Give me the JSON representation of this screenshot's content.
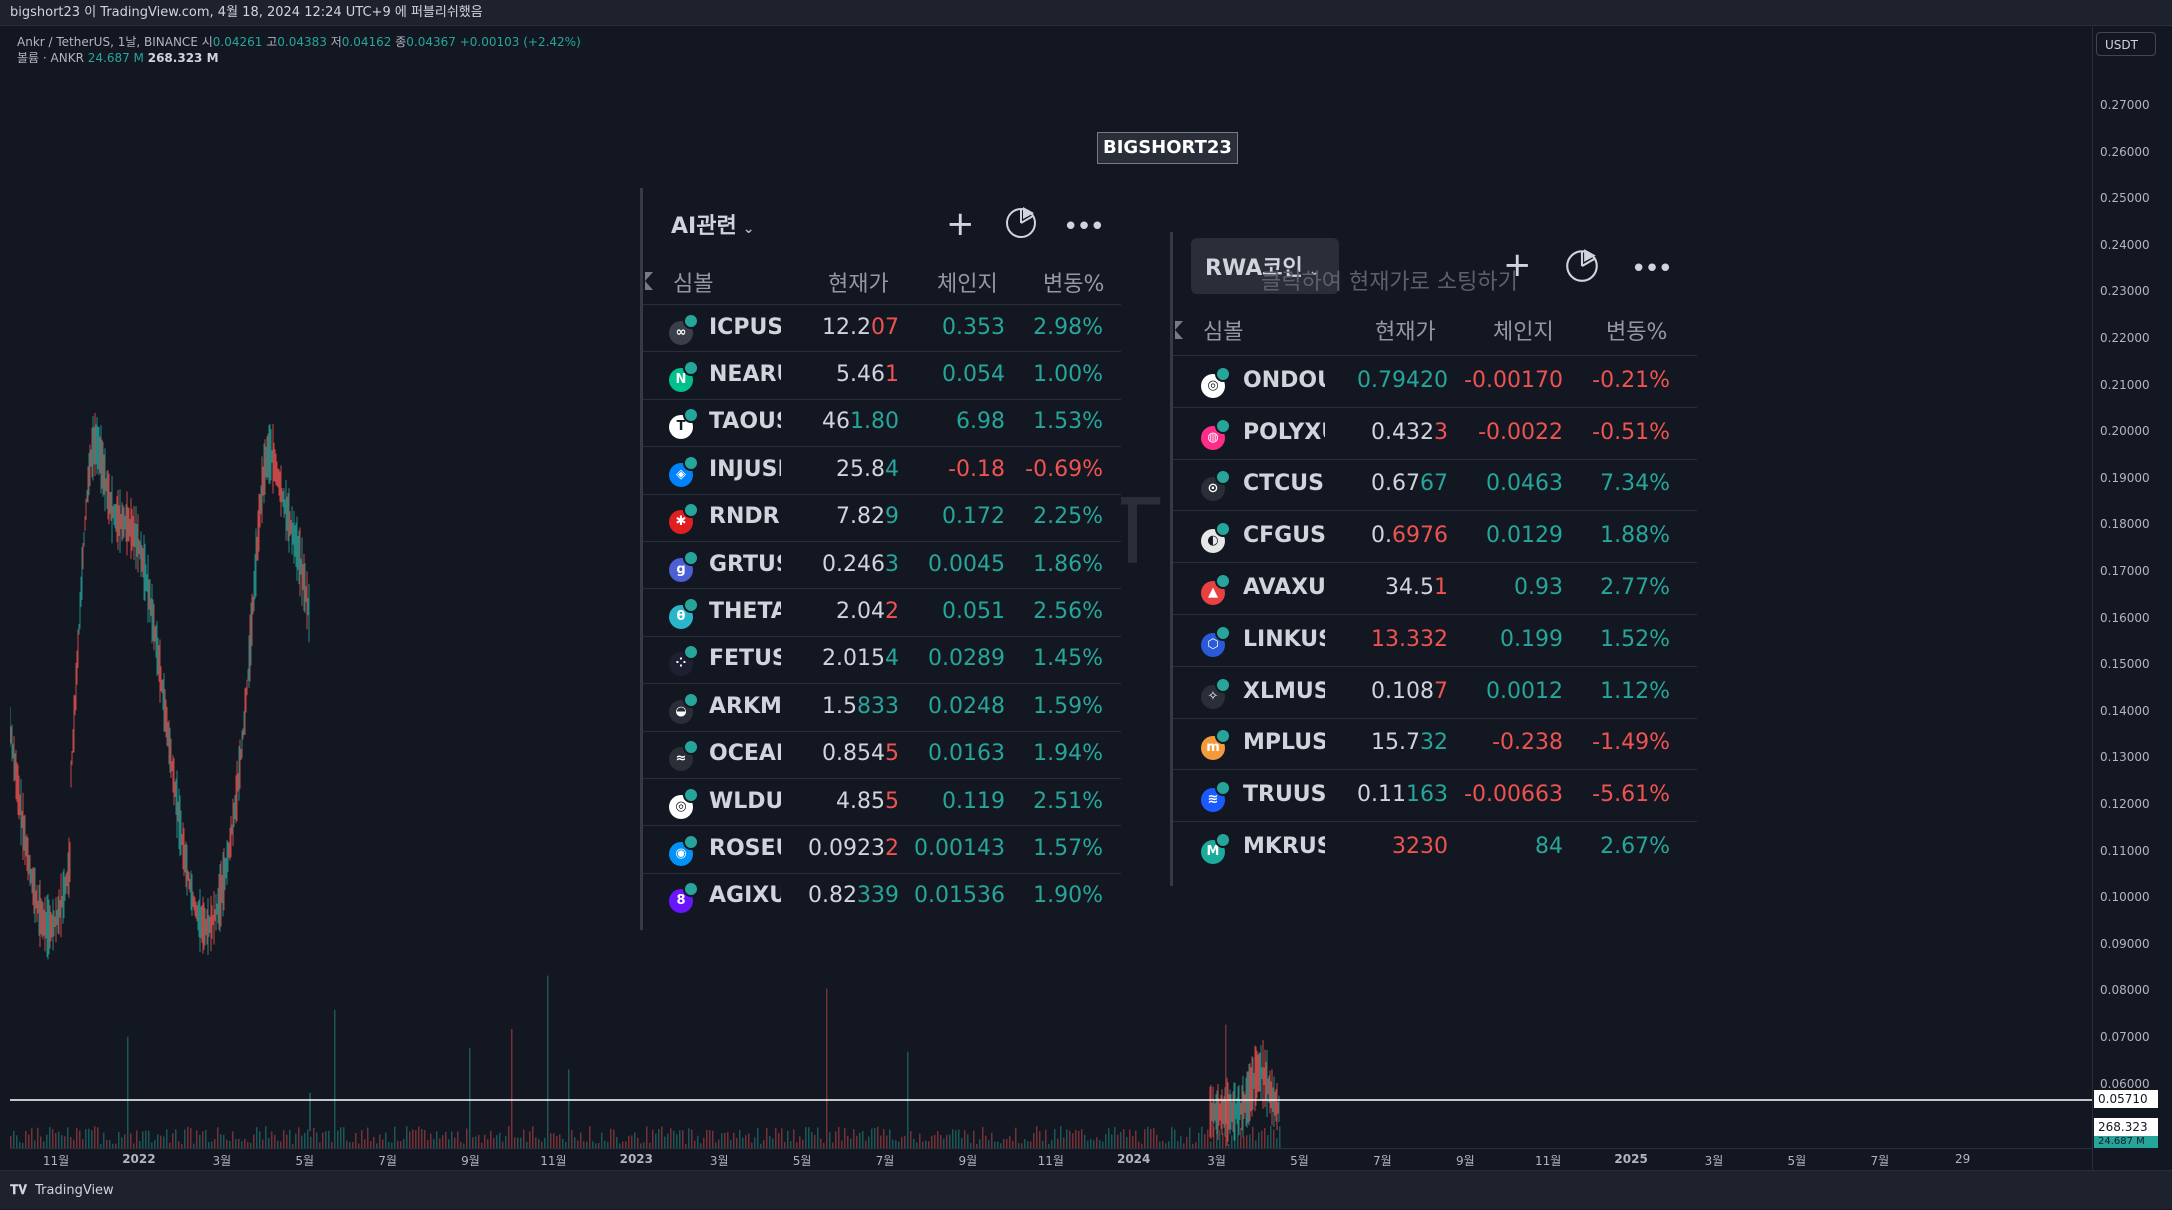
{
  "topbar": {
    "text": "bigshort23 이 TradingView.com, 4월 18, 2024 12:24 UTC+9 에 퍼블리쉬했음"
  },
  "legend": {
    "symbol_line": "Ankr / TetherUS, 1날, BINANCE",
    "o_label": "시",
    "o_value": "0.04261",
    "h_label": "고",
    "h_value": "0.04383",
    "l_label": "저",
    "l_value": "0.04162",
    "c_label": "종",
    "c_value": "0.04367",
    "change": "+0.00103 (+2.42%)",
    "volume_label": "볼륨 · ANKR",
    "volume_1": "24.687 M",
    "volume_2": "268.323 M"
  },
  "price_axis": {
    "currency": "USDT",
    "ticks": [
      "0.27000",
      "0.26000",
      "0.25000",
      "0.24000",
      "0.23000",
      "0.22000",
      "0.21000",
      "0.20000",
      "0.19000",
      "0.18000",
      "0.17000",
      "0.16000",
      "0.15000",
      "0.14000",
      "0.13000",
      "0.12000",
      "0.11000",
      "0.10000",
      "0.09000",
      "0.08000",
      "0.07000",
      "0.06000"
    ],
    "last_price": "0.05710",
    "vol_label_1": "268.323 M",
    "vol_label_2": "24.687 M"
  },
  "time_axis": {
    "ticks": [
      "11월",
      "2022",
      "3월",
      "5월",
      "7월",
      "9월",
      "11월",
      "2023",
      "3월",
      "5월",
      "7월",
      "9월",
      "11월",
      "2024",
      "3월",
      "5월",
      "7월",
      "9월",
      "11월",
      "2025",
      "3월",
      "5월",
      "7월",
      "29"
    ]
  },
  "bottombar": {
    "brand": "TradingView"
  },
  "watermark": {
    "text": "BIGSHORT23"
  },
  "colors": {
    "up": "#26a69a",
    "down": "#ef5350",
    "bg": "#131722",
    "text": "#d1d4dc"
  },
  "ai_widget": {
    "title": "AI관련",
    "icons": [
      "plus-icon",
      "pie-chart-icon",
      "more-icon"
    ],
    "headers": {
      "symbol": "심볼",
      "last": "현재가",
      "change": "체인지",
      "change_pct": "변동%"
    },
    "rows": [
      {
        "symbol": "ICPUSD",
        "last_a": "12.2",
        "last_b": "07",
        "last_b_dir": "down",
        "change": "0.353",
        "change_pct": "2.98%",
        "dir": "up",
        "icon": "∞",
        "icon_color": "#3b3f4a"
      },
      {
        "symbol": "NEARUS",
        "last_a": "5.46",
        "last_b": "1",
        "last_b_dir": "down",
        "change": "0.054",
        "change_pct": "1.00%",
        "dir": "up",
        "icon": "N",
        "icon_color": "#00c08b"
      },
      {
        "symbol": "TAOUSD",
        "last_a": "46",
        "last_b": "1.80",
        "last_b_dir": "up",
        "change": "6.98",
        "change_pct": "1.53%",
        "dir": "up",
        "icon": "T",
        "icon_color": "#ffffff"
      },
      {
        "symbol": "INJUSDT",
        "last_a": "25.8",
        "last_b": "4",
        "last_b_dir": "up",
        "change": "-0.18",
        "change_pct": "-0.69%",
        "dir": "down",
        "icon": "◈",
        "icon_color": "#0082fa"
      },
      {
        "symbol": "RNDRUS",
        "last_a": "7.82",
        "last_b": "9",
        "last_b_dir": "up",
        "change": "0.172",
        "change_pct": "2.25%",
        "dir": "up",
        "icon": "✱",
        "icon_color": "#e02020"
      },
      {
        "symbol": "GRTUSD",
        "last_a": "0.246",
        "last_b": "3",
        "last_b_dir": "up",
        "change": "0.0045",
        "change_pct": "1.86%",
        "dir": "up",
        "icon": "g",
        "icon_color": "#4c5fd5"
      },
      {
        "symbol": "THETAU",
        "last_a": "2.04",
        "last_b": "2",
        "last_b_dir": "down",
        "change": "0.051",
        "change_pct": "2.56%",
        "dir": "up",
        "icon": "θ",
        "icon_color": "#29b6c8"
      },
      {
        "symbol": "FETUSD",
        "last_a": "2.015",
        "last_b": "4",
        "last_b_dir": "up",
        "change": "0.0289",
        "change_pct": "1.45%",
        "dir": "up",
        "icon": "⁘",
        "icon_color": "#1d2030"
      },
      {
        "symbol": "ARKMUS",
        "last_a": "1.5",
        "last_b": "833",
        "last_b_dir": "up",
        "change": "0.0248",
        "change_pct": "1.59%",
        "dir": "up",
        "icon": "◒",
        "icon_color": "#2a2e39"
      },
      {
        "symbol": "OCEANU",
        "last_a": "0.854",
        "last_b": "5",
        "last_b_dir": "down",
        "change": "0.0163",
        "change_pct": "1.94%",
        "dir": "up",
        "icon": "≈",
        "icon_color": "#2a2e39"
      },
      {
        "symbol": "WLDUSD",
        "last_a": "4.85",
        "last_b": "5",
        "last_b_dir": "down",
        "change": "0.119",
        "change_pct": "2.51%",
        "dir": "up",
        "icon": "◎",
        "icon_color": "#ffffff"
      },
      {
        "symbol": "ROSEUS",
        "last_a": "0.0923",
        "last_b": "2",
        "last_b_dir": "down",
        "change": "0.00143",
        "change_pct": "1.57%",
        "dir": "up",
        "icon": "◉",
        "icon_color": "#0092f6"
      },
      {
        "symbol": "AGIXUS",
        "last_a": "0.82",
        "last_b": "339",
        "last_b_dir": "up",
        "change": "0.01536",
        "change_pct": "1.90%",
        "dir": "up",
        "icon": "8",
        "icon_color": "#6916ff"
      }
    ]
  },
  "rwa_widget": {
    "title": "RWA코인",
    "tooltip": "클릭하여 현재가로 소팅하기",
    "icons": [
      "plus-icon",
      "pie-chart-icon",
      "more-icon"
    ],
    "headers": {
      "symbol": "심볼",
      "last": "현재가",
      "change": "체인지",
      "change_pct": "변동%"
    },
    "rows": [
      {
        "symbol": "ONDOUS",
        "last_a": "",
        "last_b": "0.79420",
        "last_b_dir": "up",
        "change": "-0.00170",
        "change_pct": "-0.21%",
        "dir": "down",
        "icon": "◎",
        "icon_color": "#ffffff"
      },
      {
        "symbol": "POLYXU",
        "last_a": "0.432",
        "last_b": "3",
        "last_b_dir": "down",
        "change": "-0.0022",
        "change_pct": "-0.51%",
        "dir": "down",
        "icon": "◍",
        "icon_color": "#ff2d8a"
      },
      {
        "symbol": "CTCUSD",
        "last_a": "0.67",
        "last_b": "67",
        "last_b_dir": "up",
        "change": "0.0463",
        "change_pct": "7.34%",
        "dir": "up",
        "icon": "⊙",
        "icon_color": "#2a2e39"
      },
      {
        "symbol": "CFGUSD",
        "last_a": "0.",
        "last_b": "6976",
        "last_b_dir": "down",
        "change": "0.0129",
        "change_pct": "1.88%",
        "dir": "up",
        "icon": "◐",
        "icon_color": "#e6e6e6"
      },
      {
        "symbol": "AVAXUS",
        "last_a": "34.5",
        "last_b": "1",
        "last_b_dir": "down",
        "change": "0.93",
        "change_pct": "2.77%",
        "dir": "up",
        "icon": "▲",
        "icon_color": "#e84142"
      },
      {
        "symbol": "LINKUSD",
        "last_a": "",
        "last_b": "13.332",
        "last_b_dir": "down",
        "change": "0.199",
        "change_pct": "1.52%",
        "dir": "up",
        "icon": "⬡",
        "icon_color": "#2a5ada"
      },
      {
        "symbol": "XLMUSD",
        "last_a": "0.108",
        "last_b": "7",
        "last_b_dir": "down",
        "change": "0.0012",
        "change_pct": "1.12%",
        "dir": "up",
        "icon": "✧",
        "icon_color": "#2a2e39"
      },
      {
        "symbol": "MPLUSD",
        "last_a": "15.7",
        "last_b": "32",
        "last_b_dir": "up",
        "change": "-0.238",
        "change_pct": "-1.49%",
        "dir": "down",
        "icon": "m",
        "icon_color": "#f39a3b"
      },
      {
        "symbol": "TRUUSD",
        "last_a": "0.11",
        "last_b": "163",
        "last_b_dir": "up",
        "change": "-0.00663",
        "change_pct": "-5.61%",
        "dir": "down",
        "icon": "≋",
        "icon_color": "#1a5aff"
      },
      {
        "symbol": "MKRUSD",
        "last_a": "",
        "last_b": "3230",
        "last_b_dir": "down",
        "change": "84",
        "change_pct": "2.67%",
        "dir": "up",
        "icon": "M",
        "icon_color": "#1aab9b"
      }
    ]
  }
}
